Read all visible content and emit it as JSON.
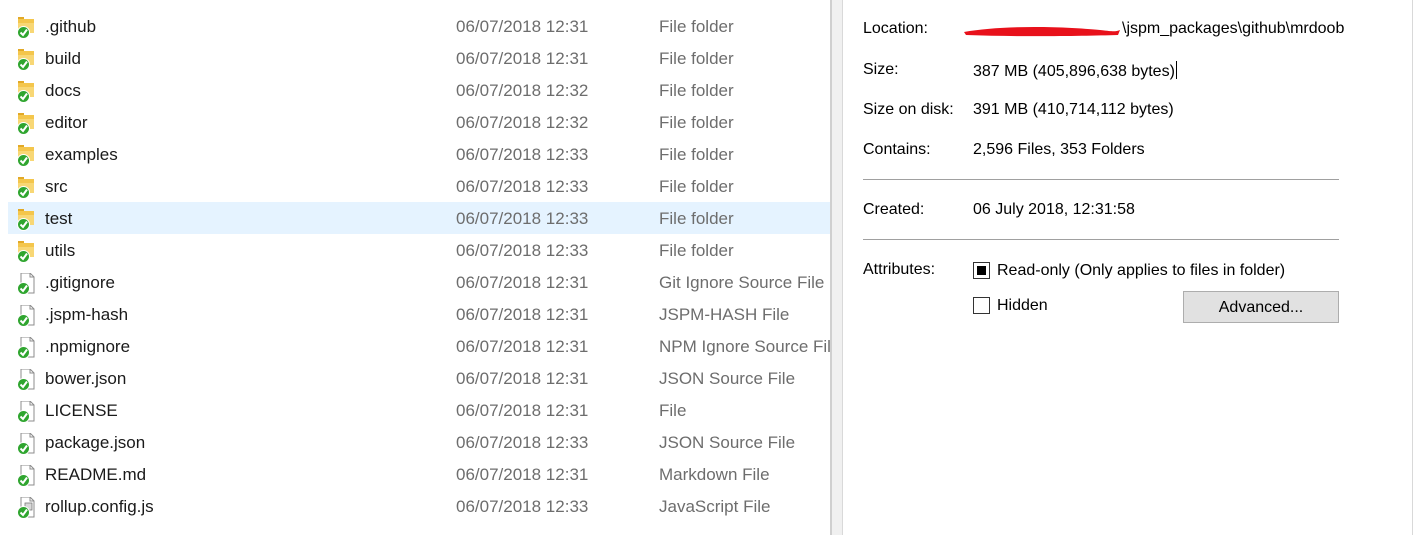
{
  "explorer": {
    "rows": [
      {
        "name": ".github",
        "date": "06/07/2018 12:31",
        "type": "File folder",
        "kind": "folder-icon"
      },
      {
        "name": "build",
        "date": "06/07/2018 12:31",
        "type": "File folder",
        "kind": "folder-icon"
      },
      {
        "name": "docs",
        "date": "06/07/2018 12:32",
        "type": "File folder",
        "kind": "folder-icon"
      },
      {
        "name": "editor",
        "date": "06/07/2018 12:32",
        "type": "File folder",
        "kind": "folder-icon"
      },
      {
        "name": "examples",
        "date": "06/07/2018 12:33",
        "type": "File folder",
        "kind": "folder-icon"
      },
      {
        "name": "src",
        "date": "06/07/2018 12:33",
        "type": "File folder",
        "kind": "folder-icon"
      },
      {
        "name": "test",
        "date": "06/07/2018 12:33",
        "type": "File folder",
        "kind": "folder-icon",
        "selected": true
      },
      {
        "name": "utils",
        "date": "06/07/2018 12:33",
        "type": "File folder",
        "kind": "folder-icon"
      },
      {
        "name": ".gitignore",
        "date": "06/07/2018 12:31",
        "type": "Git Ignore Source File",
        "kind": "file-icon"
      },
      {
        "name": ".jspm-hash",
        "date": "06/07/2018 12:31",
        "type": "JSPM-HASH File",
        "kind": "file-icon"
      },
      {
        "name": ".npmignore",
        "date": "06/07/2018 12:31",
        "type": "NPM Ignore Source File",
        "kind": "file-icon"
      },
      {
        "name": "bower.json",
        "date": "06/07/2018 12:31",
        "type": "JSON Source File",
        "kind": "file-icon"
      },
      {
        "name": "LICENSE",
        "date": "06/07/2018 12:31",
        "type": "File",
        "kind": "file-icon"
      },
      {
        "name": "package.json",
        "date": "06/07/2018 12:33",
        "type": "JSON Source File",
        "kind": "file-icon"
      },
      {
        "name": "README.md",
        "date": "06/07/2018 12:31",
        "type": "Markdown File",
        "kind": "file-icon"
      },
      {
        "name": "rollup.config.js",
        "date": "06/07/2018 12:33",
        "type": "JavaScript File",
        "kind": "script-file-icon"
      }
    ],
    "sync_badge": "green-check-icon"
  },
  "properties": {
    "location_label": "Location:",
    "location_value": "\\jspm_packages\\github\\mrdoob",
    "size_label": "Size:",
    "size_value": "387 MB (405,896,638 bytes)",
    "size_on_disk_label": "Size on disk:",
    "size_on_disk_value": "391 MB (410,714,112 bytes)",
    "contains_label": "Contains:",
    "contains_value": "2,596 Files, 353 Folders",
    "created_label": "Created:",
    "created_value": "06 July 2018, 12:31:58",
    "attributes_label": "Attributes:",
    "readonly_label": "Read-only (Only applies to files in folder)",
    "readonly_state": "indeterminate",
    "hidden_label": "Hidden",
    "hidden_checked": false,
    "advanced_label": "Advanced..."
  },
  "colors": {
    "folder": "#f4c64c",
    "check": "#2fa52f",
    "selection": "#e5f3ff",
    "redaction": "#e8111b"
  }
}
